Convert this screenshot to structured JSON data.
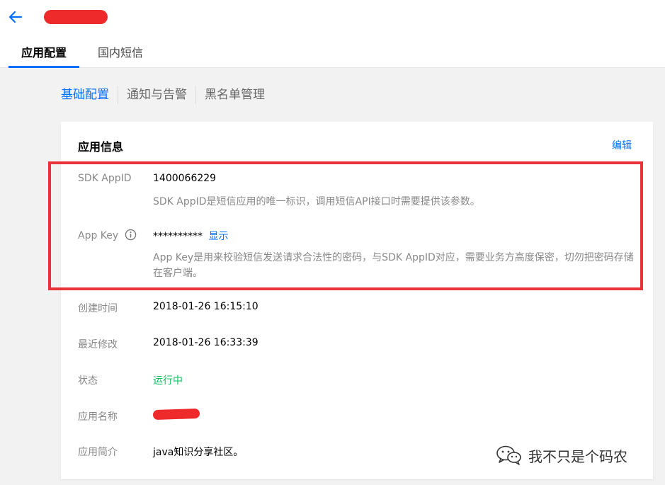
{
  "header": {
    "back_icon": "arrow-left-icon",
    "accent_color": "#006eff"
  },
  "tabs": [
    {
      "label": "应用配置",
      "active": true
    },
    {
      "label": "国内短信",
      "active": false
    }
  ],
  "subnav": {
    "items": [
      "基础配置",
      "通知与告警",
      "黑名单管理"
    ],
    "active_index": 0
  },
  "card": {
    "title": "应用信息",
    "edit_label": "编辑",
    "sdk_appid": {
      "label": "SDK AppID",
      "value": "1400066229",
      "description": "SDK AppID是短信应用的唯一标识，调用短信API接口时需要提供该参数。"
    },
    "app_key": {
      "label": "App Key",
      "value": "**********",
      "show_label": "显示",
      "description": "App Key是用来校验短信发送请求合法性的密码，与SDK AppID对应，需要业务方高度保密，切勿把密码存储在客户端。"
    },
    "created": {
      "label": "创建时间",
      "value": "2018-01-26 16:15:10"
    },
    "modified": {
      "label": "最近修改",
      "value": "2018-01-26 16:33:39"
    },
    "status": {
      "label": "状态",
      "value": "运行中",
      "color": "#0abf5b"
    },
    "app_name": {
      "label": "应用名称"
    },
    "app_intro": {
      "label": "应用简介",
      "value": "java知识分享社区。"
    }
  },
  "highlight_color": "#e9323a",
  "watermark": {
    "text": "我不只是个码农",
    "icon": "wechat-icon"
  }
}
